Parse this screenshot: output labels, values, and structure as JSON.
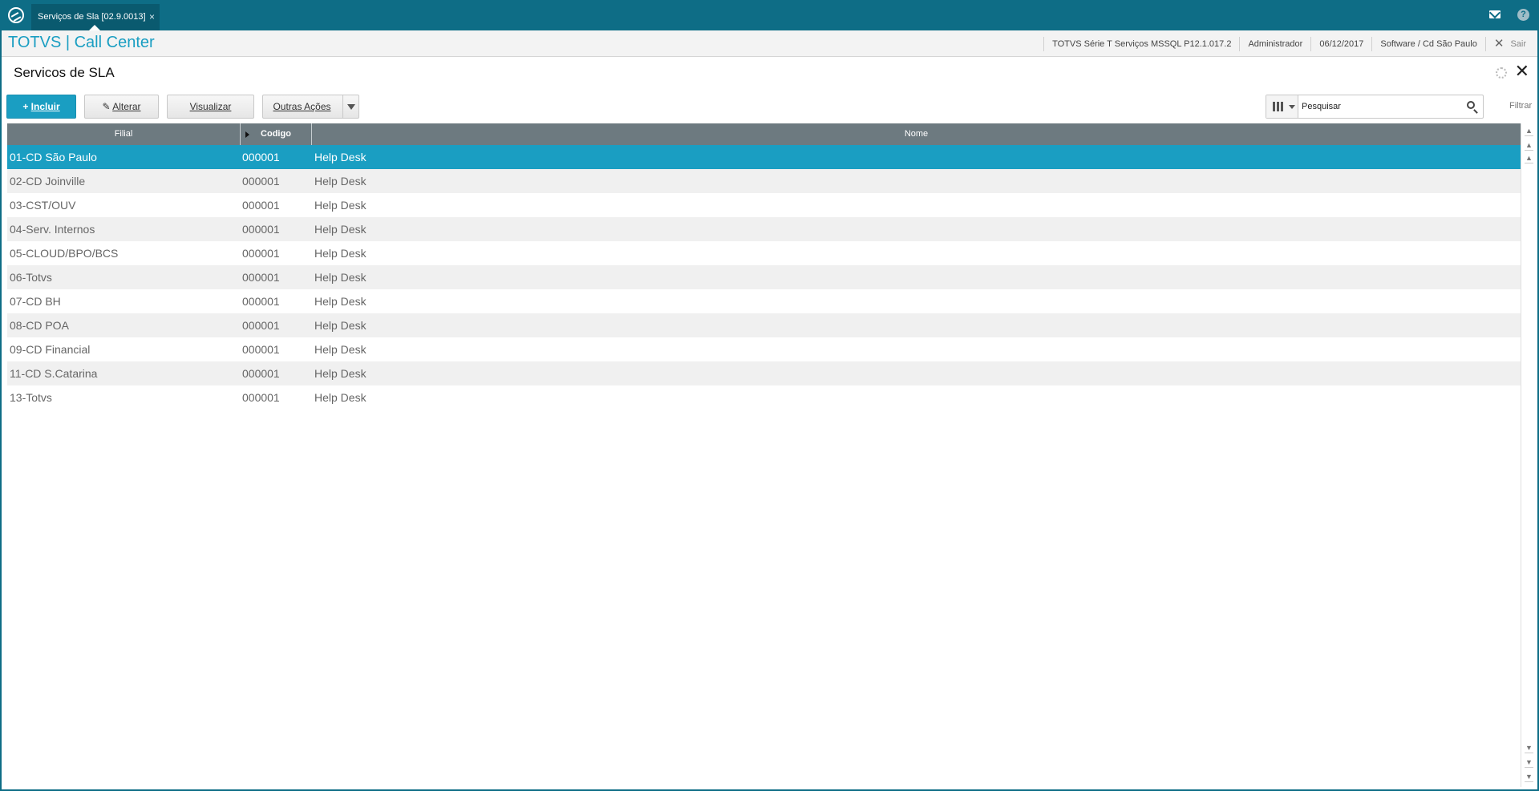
{
  "tab": {
    "label": "Serviços de Sla [02.9.0013]",
    "close": "×"
  },
  "header": {
    "app_title": "TOTVS | Call Center",
    "environment": "TOTVS Série T Serviços MSSQL P12.1.017.2",
    "user": "Administrador",
    "date": "06/12/2017",
    "branch": "Software / Cd São Paulo",
    "logout_label": "Sair"
  },
  "page": {
    "title": "Servicos de SLA"
  },
  "toolbar": {
    "incluir_label": "Incluir",
    "alterar_label": "Alterar",
    "visualizar_label": "Visualizar",
    "outras_label": "Outras Ações"
  },
  "search": {
    "placeholder": "Pesquisar",
    "filter_label": "Filtrar"
  },
  "grid": {
    "columns": [
      "Filial",
      "Codigo",
      "Nome"
    ],
    "rows": [
      [
        "01-CD São Paulo",
        "000001",
        "Help Desk"
      ],
      [
        "02-CD Joinville",
        "000001",
        "Help Desk"
      ],
      [
        "03-CST/OUV",
        "000001",
        "Help Desk"
      ],
      [
        "04-Serv. Internos",
        "000001",
        "Help Desk"
      ],
      [
        "05-CLOUD/BPO/BCS",
        "000001",
        "Help Desk"
      ],
      [
        "06-Totvs",
        "000001",
        "Help Desk"
      ],
      [
        "07-CD BH",
        "000001",
        "Help Desk"
      ],
      [
        "08-CD POA",
        "000001",
        "Help Desk"
      ],
      [
        "09-CD Financial",
        "000001",
        "Help Desk"
      ],
      [
        "11-CD S.Catarina",
        "000001",
        "Help Desk"
      ],
      [
        "13-Totvs",
        "000001",
        "Help Desk"
      ]
    ],
    "selected_row": 0
  },
  "colors": {
    "brand": "#0e6d86",
    "accent": "#1a9ec2",
    "header_grid": "#6d7a80"
  }
}
